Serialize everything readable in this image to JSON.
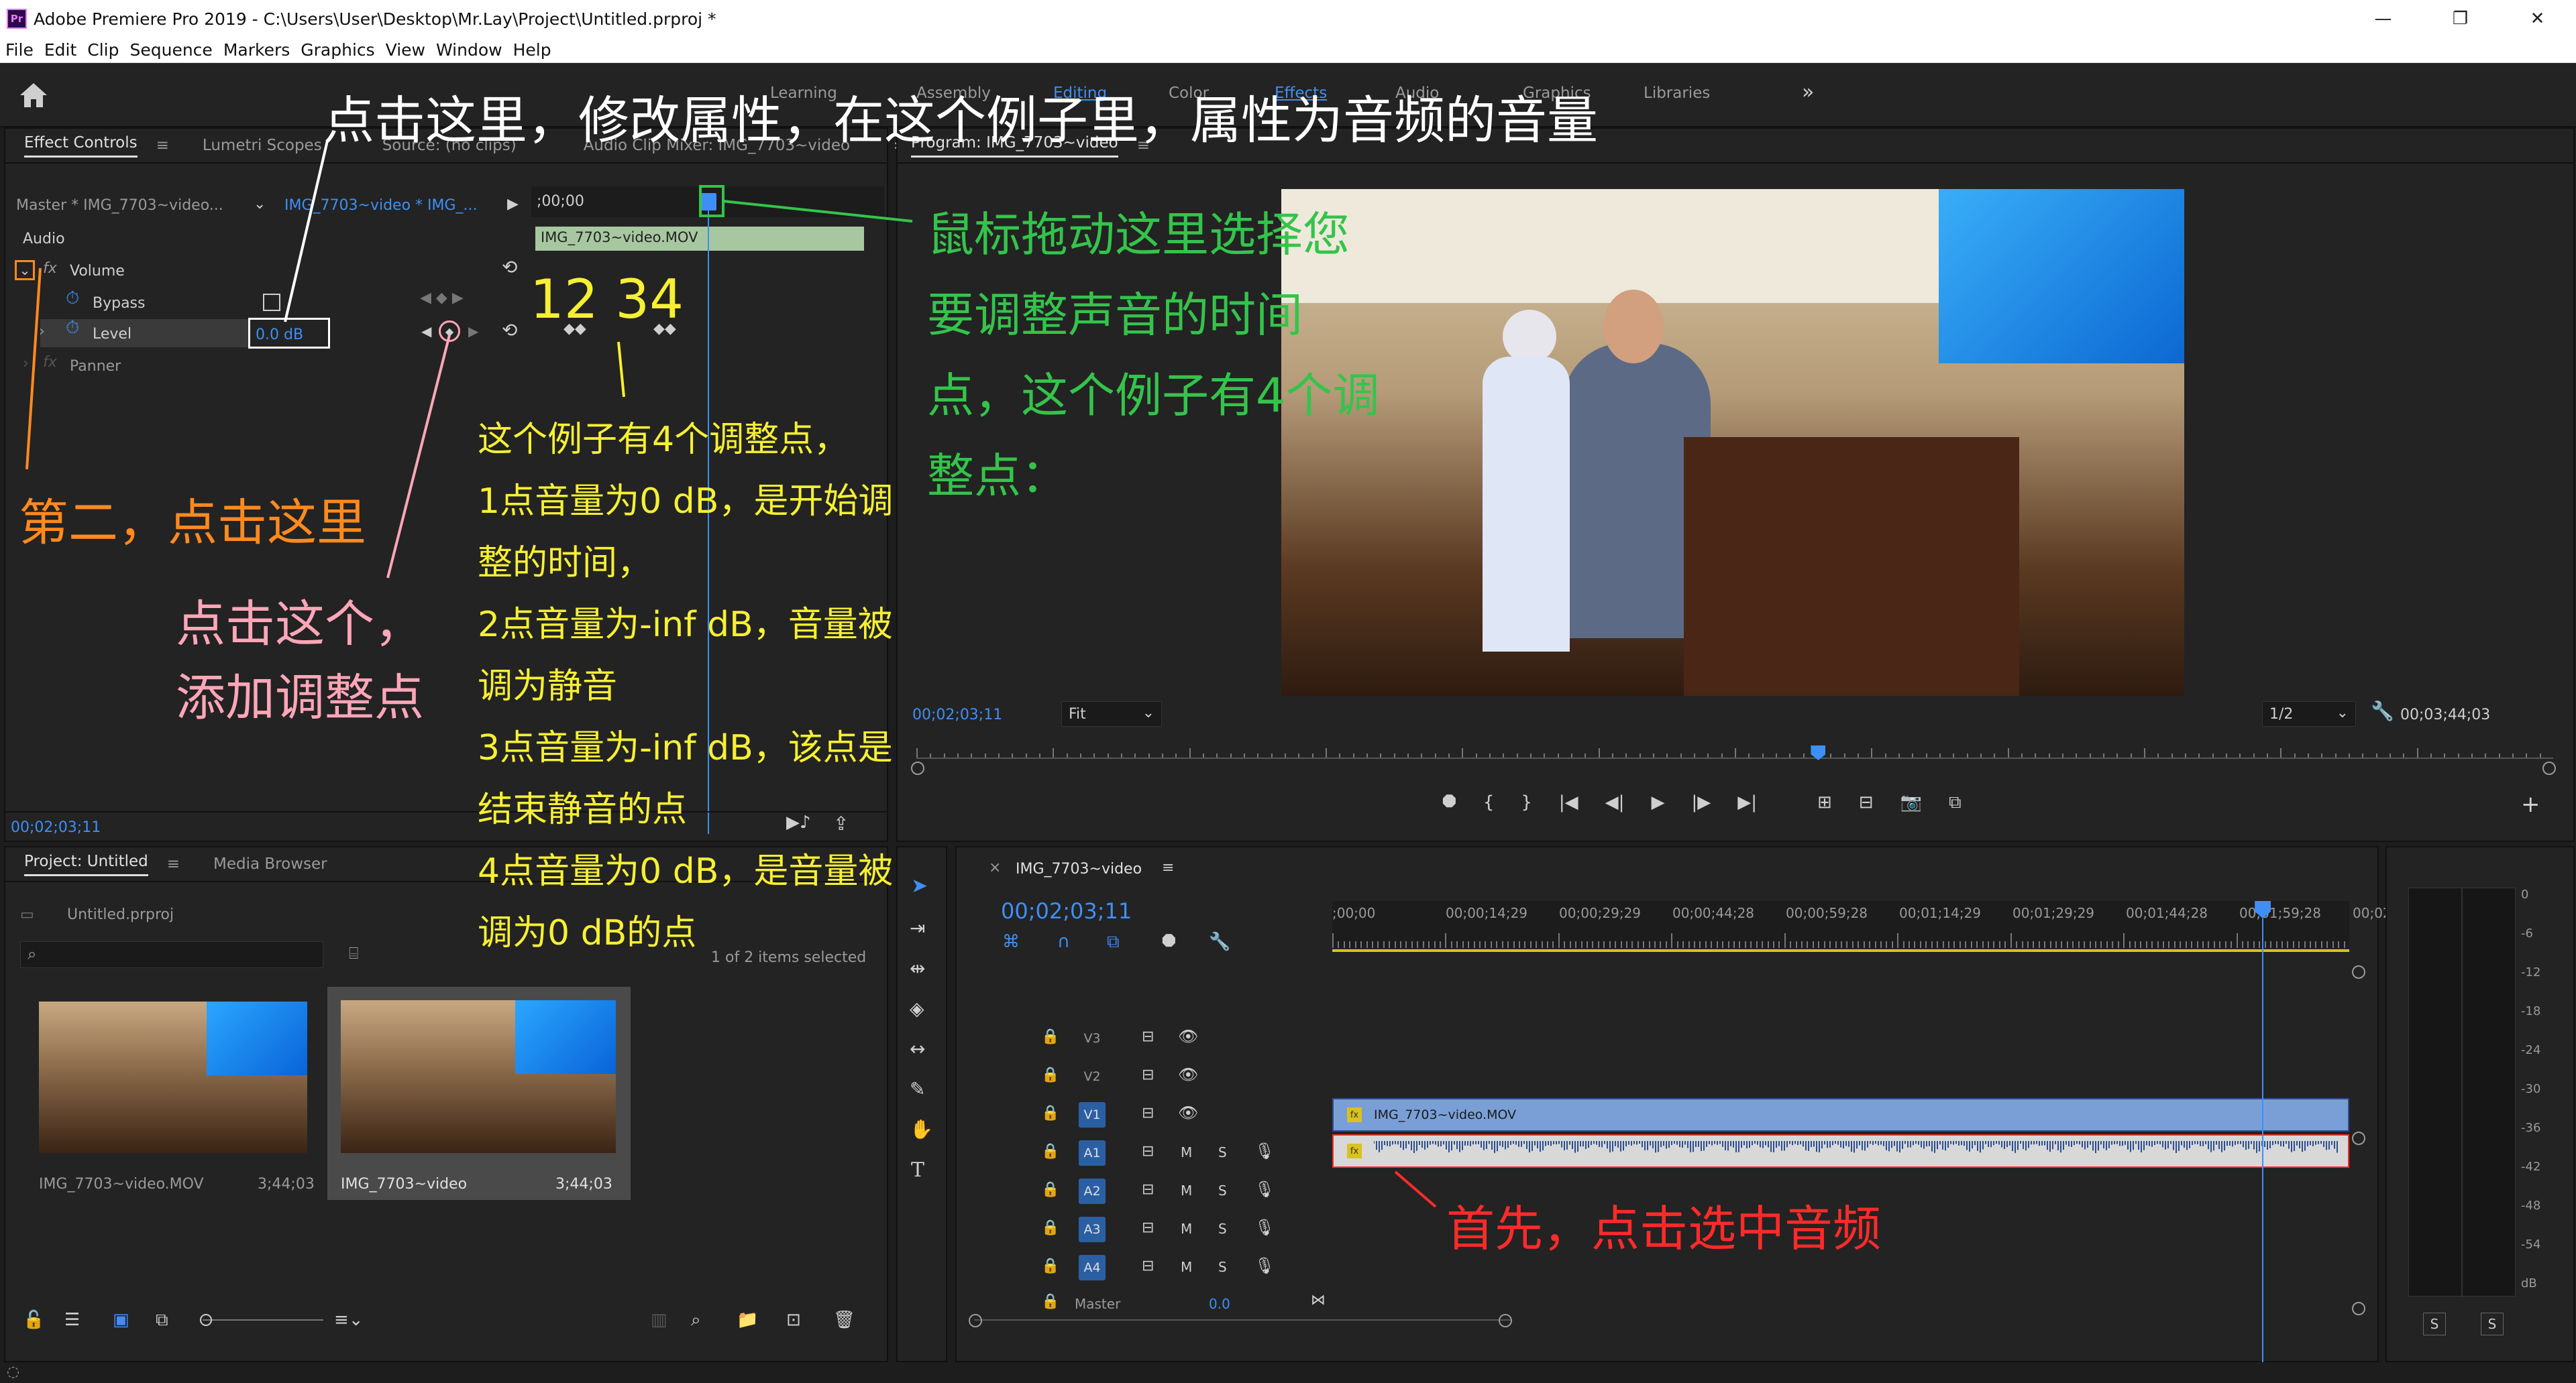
{
  "window": {
    "app_icon": "Pr",
    "title": "Adobe Premiere Pro 2019 - C:\\Users\\User\\Desktop\\Mr.Lay\\Project\\Untitled.prproj *",
    "minimize": "—",
    "maximize": "❐",
    "close": "✕"
  },
  "menu": [
    "File",
    "Edit",
    "Clip",
    "Sequence",
    "Markers",
    "Graphics",
    "View",
    "Window",
    "Help"
  ],
  "workspaces": [
    "Learning",
    "Assembly",
    "Editing",
    "Color",
    "Effects",
    "Audio",
    "Graphics",
    "Libraries"
  ],
  "workspace_more": "»",
  "effect_panel": {
    "tabs": [
      "Effect Controls",
      "Lumetri Scopes",
      "Source: (no clips)",
      "Audio Clip Mixer: IMG_7703~video"
    ],
    "tab_more": "»",
    "master_select": "Master * IMG_7703~video...",
    "sequence_link": "IMG_7703~video * IMG_...",
    "time_start": ";00;00",
    "clip_name": "IMG_7703~video.MOV",
    "section_audio": "Audio",
    "volume": "Volume",
    "bypass": "Bypass",
    "level": "Level",
    "level_value": "0.0 dB",
    "panner": "Panner",
    "current_time": "00;02;03;11"
  },
  "program_panel": {
    "title": "Program: IMG_7703~video",
    "menu_icon": "≡",
    "timecode": "00;02;03;11",
    "fit": "Fit",
    "resolution": "1/2",
    "duration": "00;03;44;03",
    "playhead_fraction": 0.551,
    "transport": [
      "marker-icon",
      "in-point-icon",
      "out-point-icon",
      "go-to-in-icon",
      "step-back-icon",
      "play-icon",
      "step-forward-icon",
      "go-to-out-icon",
      "lift-icon",
      "extract-icon",
      "camera-icon",
      "button-editor-icon"
    ],
    "transport_glyphs": [
      "⯃",
      "{",
      "}",
      "|◀",
      "◀|",
      "▶",
      "|▶",
      "▶|",
      "⊞",
      "⊟",
      "📷",
      "⧉"
    ],
    "add_button": "+"
  },
  "project_panel": {
    "tabs": [
      "Project: Untitled",
      "Media Browser"
    ],
    "project_file": "Untitled.prproj",
    "selection_info": "1 of 2 items selected",
    "items": [
      {
        "name": "IMG_7703~video.MOV",
        "duration": "3;44;03"
      },
      {
        "name": "IMG_7703~video",
        "duration": "3;44;03"
      }
    ]
  },
  "timeline_panel": {
    "tab_close": "×",
    "sequence_name": "IMG_7703~video",
    "timecode": "00;02;03;11",
    "ruler": [
      ";00;00",
      "00;00;14;29",
      "00;00;29;29",
      "00;00;44;28",
      "00;00;59;28",
      "00;01;14;29",
      "00;01;29;29",
      "00;01;44;28",
      "00;01;59;28",
      "00;02"
    ],
    "playhead_fraction": 0.915,
    "video_tracks": [
      "V3",
      "V2",
      "V1"
    ],
    "audio_tracks": [
      "A1",
      "A2",
      "A3",
      "A4"
    ],
    "track_m": "M",
    "track_s": "S",
    "master_label": "Master",
    "master_value": "0.0",
    "video_clip": "IMG_7703~video.MOV"
  },
  "meter": {
    "scale": [
      "0",
      "-6",
      "-12",
      "-18",
      "-24",
      "-30",
      "-36",
      "-42",
      "-48",
      "-54",
      "dB"
    ],
    "solo": [
      "S",
      "S"
    ]
  },
  "annotations": {
    "top": "点击这里，修改属性，在这个例子里，属性为音频的音量",
    "green": [
      "鼠标拖动这里选择您",
      "要调整声音的时间",
      "点，这个例子有4个调",
      "整点："
    ],
    "keyframe_numbers": "12  34",
    "yellow": [
      "这个例子有4个调整点，",
      "1点音量为0 dB，是开始调",
      "整的时间，",
      "2点音量为-inf dB，音量被",
      "调为静音",
      "3点音量为-inf dB，该点是",
      "结束静音的点",
      "4点音量为0 dB，是音量被",
      "调为0 dB的点"
    ],
    "orange": "第二，点击这里",
    "pink": [
      "点击这个，",
      "添加调整点"
    ],
    "red": "首先，点击选中音频"
  },
  "colors": {
    "accent_blue": "#3e8ff5",
    "annotation_green": "#34c44b",
    "annotation_yellow": "#f6f033",
    "annotation_orange": "#ff8a1e",
    "annotation_pink": "#ffa6b8",
    "annotation_red": "#ff2a2a",
    "clip_video": "#7a9fd6",
    "clip_audio": "#c8c8c8"
  }
}
